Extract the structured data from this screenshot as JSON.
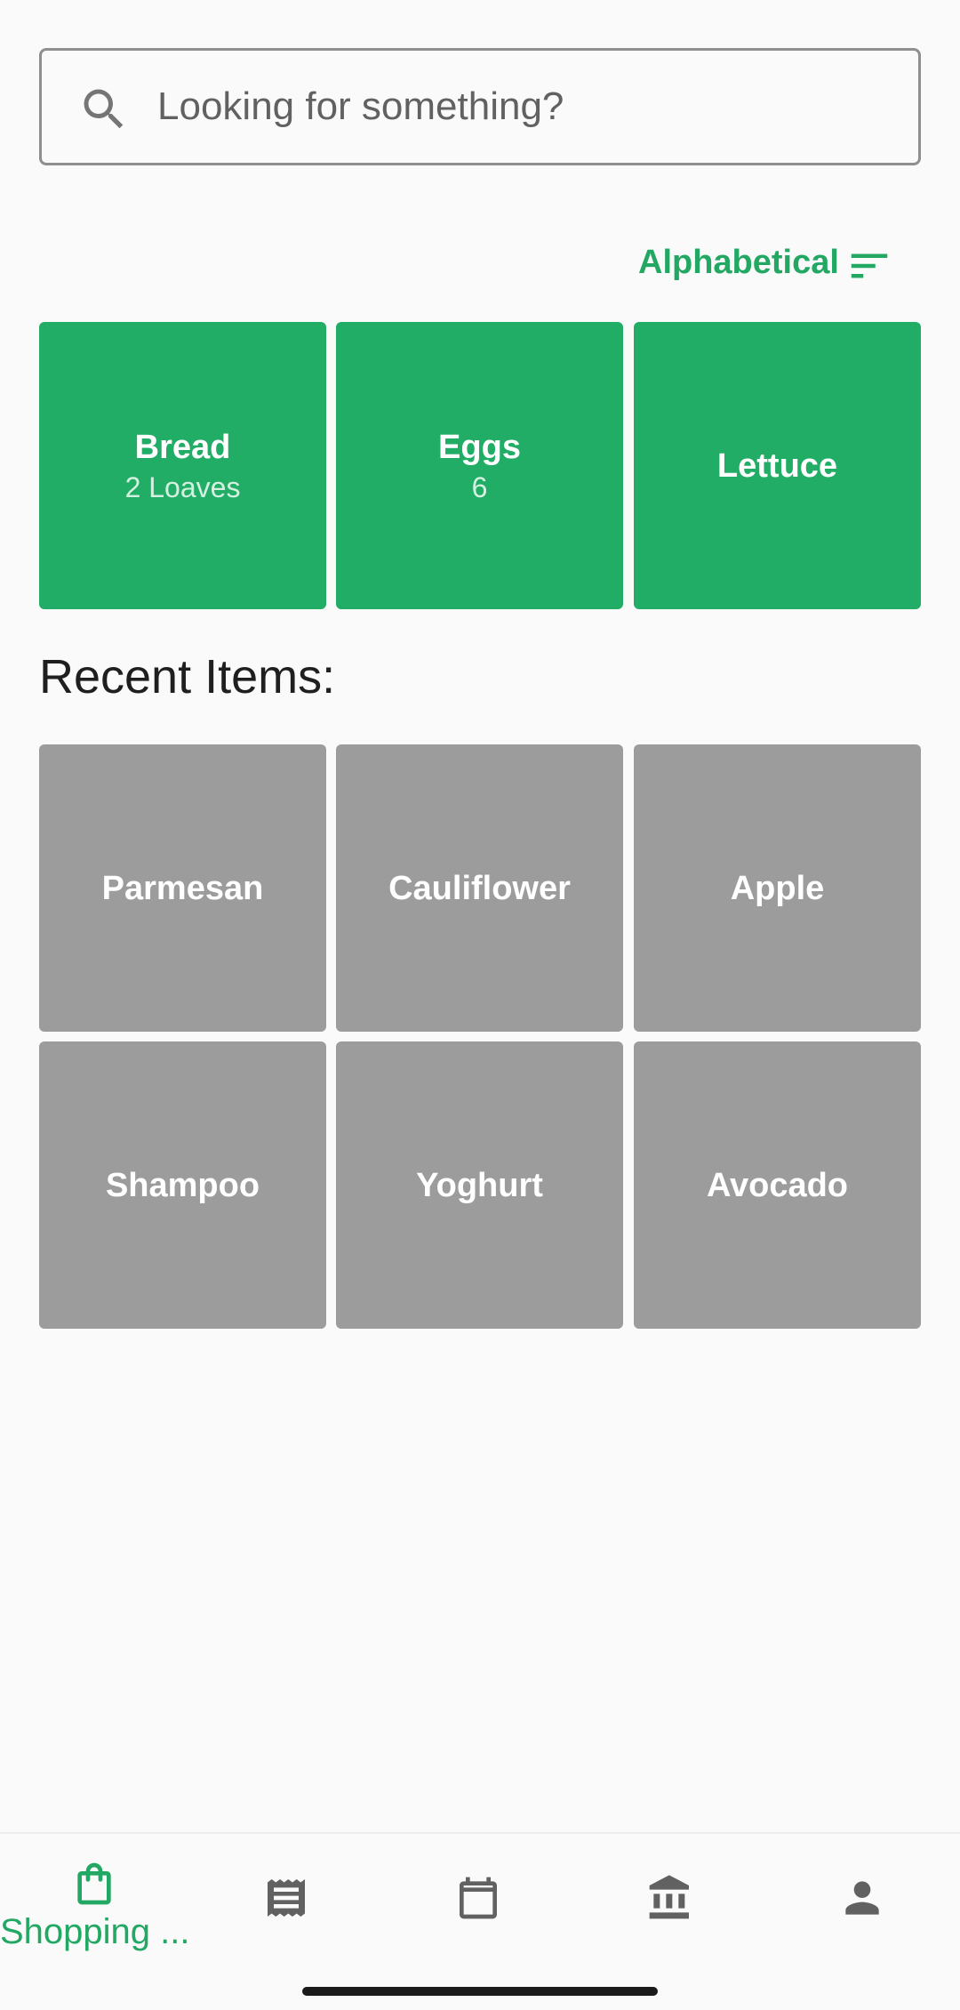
{
  "search": {
    "placeholder": "Looking for something?"
  },
  "sort": {
    "label": "Alphabetical"
  },
  "shopping_list": [
    {
      "name": "Bread",
      "quantity": "2 Loaves"
    },
    {
      "name": "Eggs",
      "quantity": "6"
    },
    {
      "name": "Lettuce",
      "quantity": ""
    }
  ],
  "recent_title": "Recent Items:",
  "recent_items": [
    {
      "name": "Parmesan"
    },
    {
      "name": "Cauliflower"
    },
    {
      "name": "Apple"
    },
    {
      "name": "Shampoo"
    },
    {
      "name": "Yoghurt"
    },
    {
      "name": "Avocado"
    }
  ],
  "bottom_nav": [
    {
      "label": "Shopping ...",
      "icon": "shopping-bag-icon",
      "active": true
    },
    {
      "label": "",
      "icon": "receipt-icon",
      "active": false
    },
    {
      "label": "",
      "icon": "calendar-icon",
      "active": false
    },
    {
      "label": "",
      "icon": "bank-icon",
      "active": false
    },
    {
      "label": "",
      "icon": "person-icon",
      "active": false
    }
  ],
  "colors": {
    "accent": "#22a863",
    "tile_active": "#22ad66",
    "tile_recent": "#9c9c9c",
    "icon_inactive": "#616161"
  }
}
